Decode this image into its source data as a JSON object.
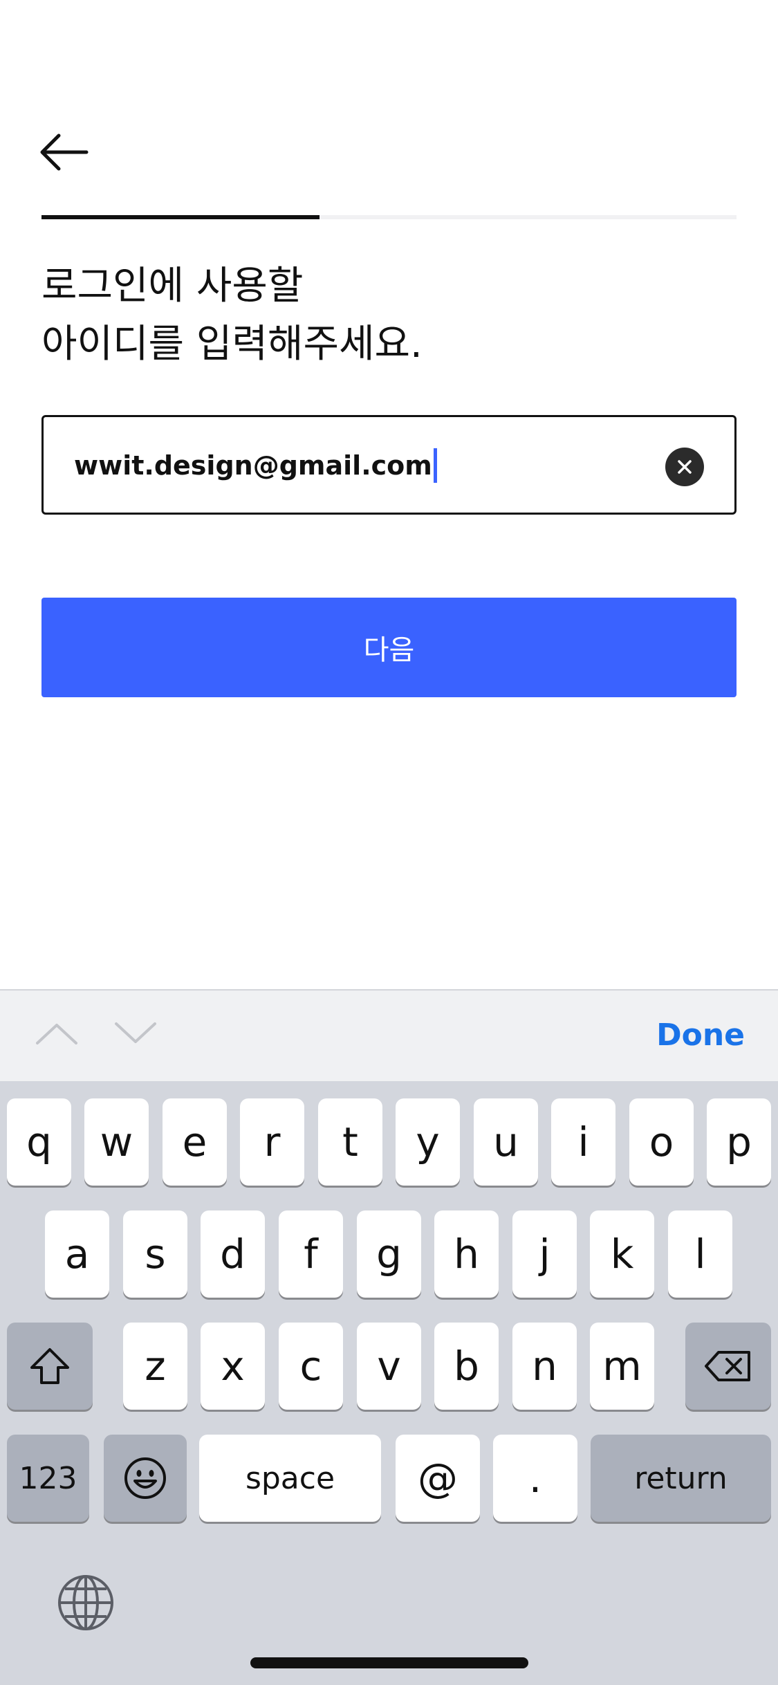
{
  "header": {
    "back_icon": "arrow-left-icon"
  },
  "progress": {
    "fraction": 0.4
  },
  "headline": {
    "line1": "로그인에 사용할",
    "line2": "아이디를 입력해주세요."
  },
  "id_field": {
    "value": "wwit.design@gmail.com",
    "clear_icon": "clear-circle-icon"
  },
  "next_button": {
    "label": "다음",
    "color": "#3a62ff"
  },
  "keyboard_accessory": {
    "prev_icon": "chevron-up-icon",
    "next_icon": "chevron-down-icon",
    "done_label": "Done",
    "done_color": "#1a73e8"
  },
  "keyboard": {
    "row1": [
      "q",
      "w",
      "e",
      "r",
      "t",
      "y",
      "u",
      "i",
      "o",
      "p"
    ],
    "row2": [
      "a",
      "s",
      "d",
      "f",
      "g",
      "h",
      "j",
      "k",
      "l"
    ],
    "row3": [
      "z",
      "x",
      "c",
      "v",
      "b",
      "n",
      "m"
    ],
    "shift_icon": "shift-icon",
    "delete_icon": "delete-icon",
    "numbers_label": "123",
    "emoji_icon": "emoji-icon",
    "space_label": "space",
    "at_label": "@",
    "dot_label": ".",
    "return_label": "return",
    "globe_icon": "globe-icon"
  }
}
